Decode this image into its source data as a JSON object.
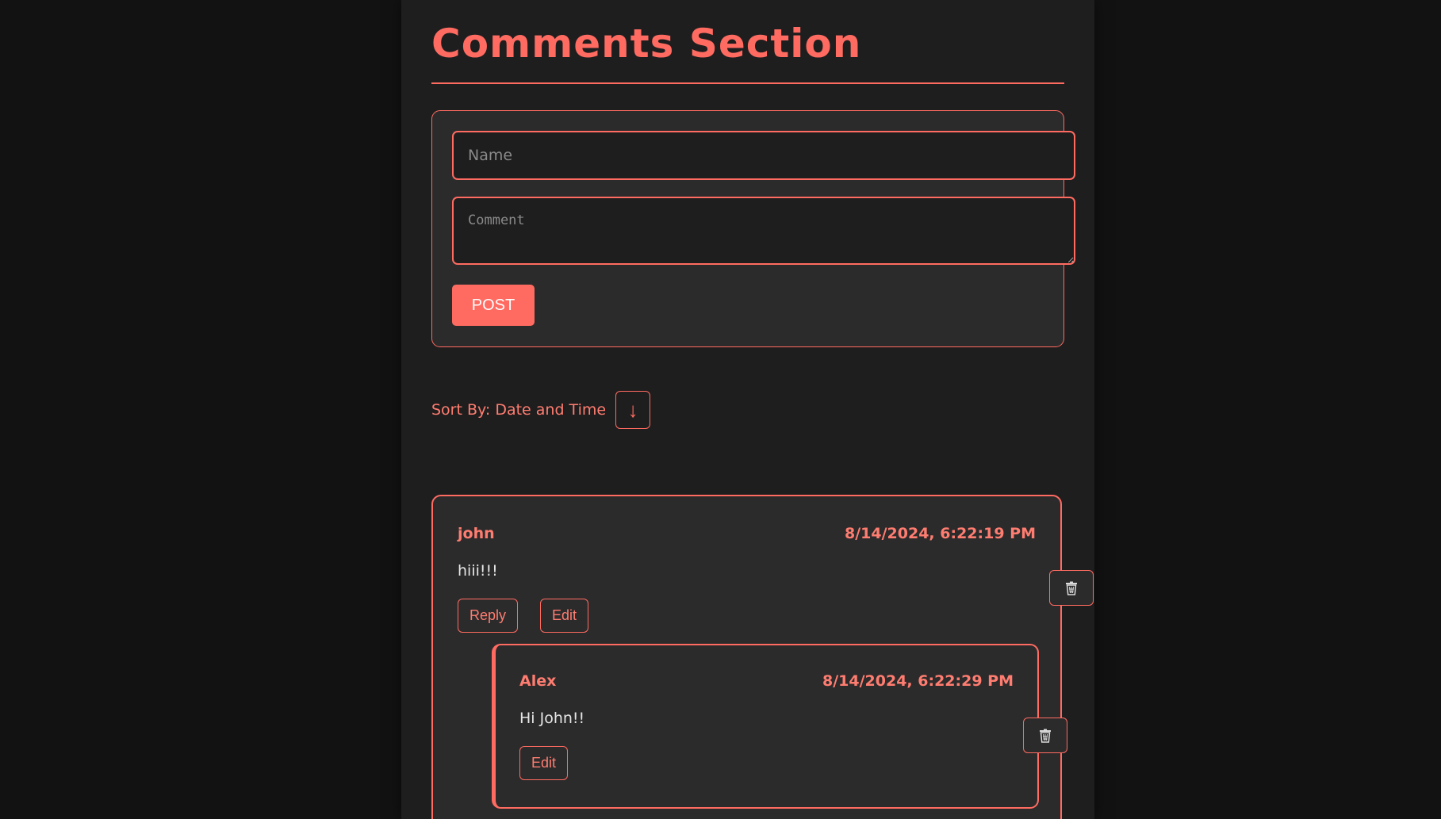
{
  "header": {
    "title": "Comments Section"
  },
  "form": {
    "name_placeholder": "Name",
    "name_value": "",
    "comment_placeholder": "Comment",
    "comment_value": "",
    "post_label": "POST"
  },
  "sort": {
    "label": "Sort By: Date and Time",
    "direction_glyph": "↓",
    "direction_icon": "arrow-down-icon"
  },
  "comments": [
    {
      "author": "john",
      "timestamp": "8/14/2024, 6:22:19 PM",
      "text": "hiii!!!",
      "reply_label": "Reply",
      "edit_label": "Edit",
      "delete_icon": "trash-icon",
      "replies": [
        {
          "author": "Alex",
          "timestamp": "8/14/2024, 6:22:29 PM",
          "text": "Hi John!!",
          "edit_label": "Edit",
          "delete_icon": "trash-icon"
        }
      ]
    }
  ],
  "colors": {
    "accent": "#ff6b61",
    "page_background": "#1f1e1f",
    "card_background": "#2c2b2c",
    "outer_background": "#121212"
  }
}
